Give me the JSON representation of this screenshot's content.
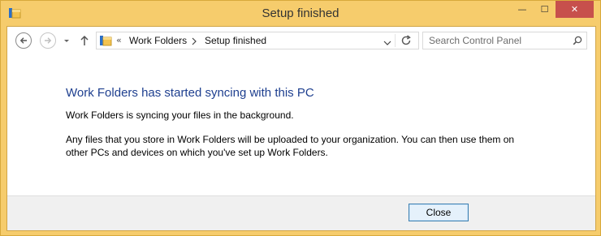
{
  "window": {
    "title": "Setup finished",
    "controls": {
      "minimize": "—",
      "maximize": "☐",
      "close": "✕"
    }
  },
  "toolbar": {
    "back_icon": "back-arrow-icon",
    "forward_icon": "forward-arrow-icon",
    "recent_icon": "chevron-down-icon",
    "up_icon": "up-arrow-icon"
  },
  "address_bar": {
    "overflow": "«",
    "segments": [
      "Work Folders",
      "Setup finished"
    ]
  },
  "search": {
    "placeholder": "Search Control Panel"
  },
  "content": {
    "heading": "Work Folders has started syncing with this PC",
    "line1": "Work Folders is syncing your files in the background.",
    "line2": "Any files that you store in Work Folders will be uploaded to your organization. You can then use them on other PCs and devices on which you've set up Work Folders."
  },
  "footer": {
    "close_label": "Close"
  },
  "colors": {
    "frame": "#f6cc6c",
    "heading": "#1e3f8f",
    "close_hover": "#c7504c"
  }
}
